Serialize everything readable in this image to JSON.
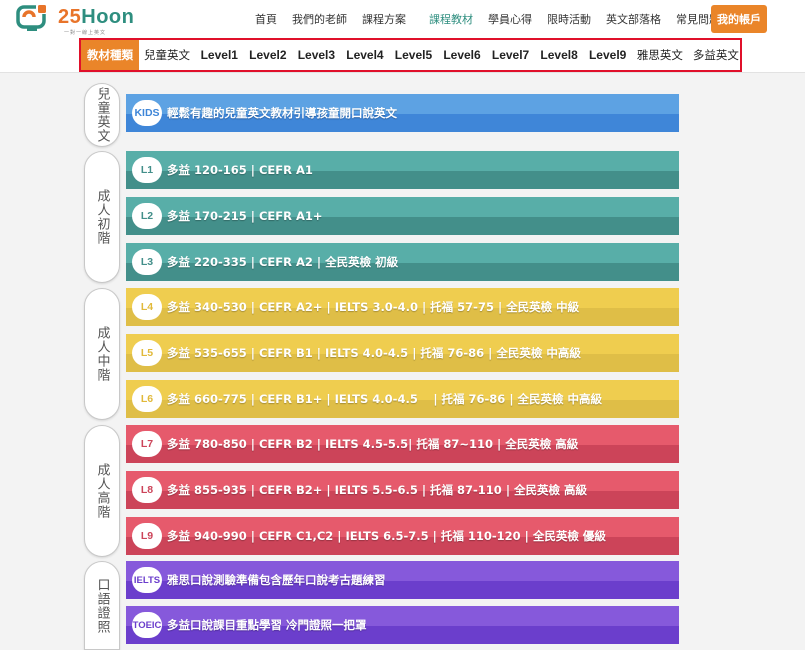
{
  "header": {
    "logo_num": "25",
    "logo_word": "Hoon",
    "logo_tagline": "一對一線上英文",
    "nav": [
      "首頁",
      "我們的老師",
      "課程方案",
      "課程教材",
      "學員心得",
      "限時活動",
      "英文部落格",
      "常見問題"
    ],
    "active_nav": "課程教材",
    "account_label": "我的帳戶",
    "colors": {
      "accent": "#ea8529",
      "brand_teal": "#2e8e7f"
    }
  },
  "categories": {
    "items": [
      "教材種類",
      "兒童英文",
      "Level1",
      "Level2",
      "Level3",
      "Level4",
      "Level5",
      "Level6",
      "Level7",
      "Level8",
      "Level9",
      "雅思英文",
      "多益英文"
    ],
    "active": "教材種類",
    "highlight_color": "#e0102a"
  },
  "groups": [
    {
      "label": "兒童英文"
    },
    {
      "label": "成人初階"
    },
    {
      "label": "成人中階"
    },
    {
      "label": "成人高階"
    },
    {
      "label": "口語證照"
    }
  ],
  "courses": [
    {
      "badge": "KIDS",
      "text": "輕鬆有趣的兒童英文教材引導孩童開口說英文",
      "color": "#3f86d8"
    },
    {
      "badge": "L1",
      "text": "多益 120-165 | CEFR A1",
      "color": "#438f8a"
    },
    {
      "badge": "L2",
      "text": "多益 170-215 | CEFR A1+",
      "color": "#438f8a"
    },
    {
      "badge": "L3",
      "text": "多益 220-335 | CEFR A2 | 全民英檢 初級",
      "color": "#438f8a"
    },
    {
      "badge": "L4",
      "text": "多益 340-530 | CEFR A2+ | IELTS 3.0-4.0 | 托福 57-75 | 全民英檢 中級",
      "color": "#e1b93a"
    },
    {
      "badge": "L5",
      "text": "多益 535-655 | CEFR B1 | IELTS 4.0-4.5 | 托福 76-86 | 全民英檢 中高級",
      "color": "#e1b93a"
    },
    {
      "badge": "L6",
      "text": "多益 660-775 | CEFR B1+ | IELTS 4.0-4.5 　| 托福 76-86 | 全民英檢 中高級",
      "color": "#e1b93a"
    },
    {
      "badge": "L7",
      "text": "多益 780-850 | CEFR B2 | IELTS 4.5-5.5| 托福 87~110 | 全民英檢 高級",
      "color": "#cc4459"
    },
    {
      "badge": "L8",
      "text": "多益 855-935 | CEFR B2+ | IELTS 5.5-6.5 | 托福 87-110 | 全民英檢 高級",
      "color": "#cc4459"
    },
    {
      "badge": "L9",
      "text": "多益 940-990 | CEFR C1,C2 | IELTS 6.5-7.5 | 托福 110-120 | 全民英檢 優級",
      "color": "#cc4459"
    },
    {
      "badge": "IELTS",
      "text": "雅思口說測驗準備包含歷年口說考古題練習",
      "color": "#6b3ecc"
    },
    {
      "badge": "TOEIC",
      "text": "多益口說課目重點學習 冷門證照一把罩",
      "color": "#6b3ecc"
    }
  ]
}
